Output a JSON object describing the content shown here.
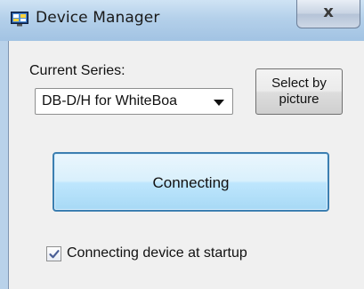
{
  "window": {
    "title": "Device Manager",
    "close_label": "x",
    "accent_color": "#a2c3e3",
    "icon": "device-manager-icon"
  },
  "series": {
    "label": "Current Series:",
    "selected_value": "DB-D/H for WhiteBoa",
    "select_by_picture_label_line1": "Select by",
    "select_by_picture_label_line2": "picture"
  },
  "connect": {
    "button_label": "Connecting",
    "button_color": "#bee6fd"
  },
  "startup": {
    "checkbox_label": "Connecting device at startup",
    "checked": true
  }
}
